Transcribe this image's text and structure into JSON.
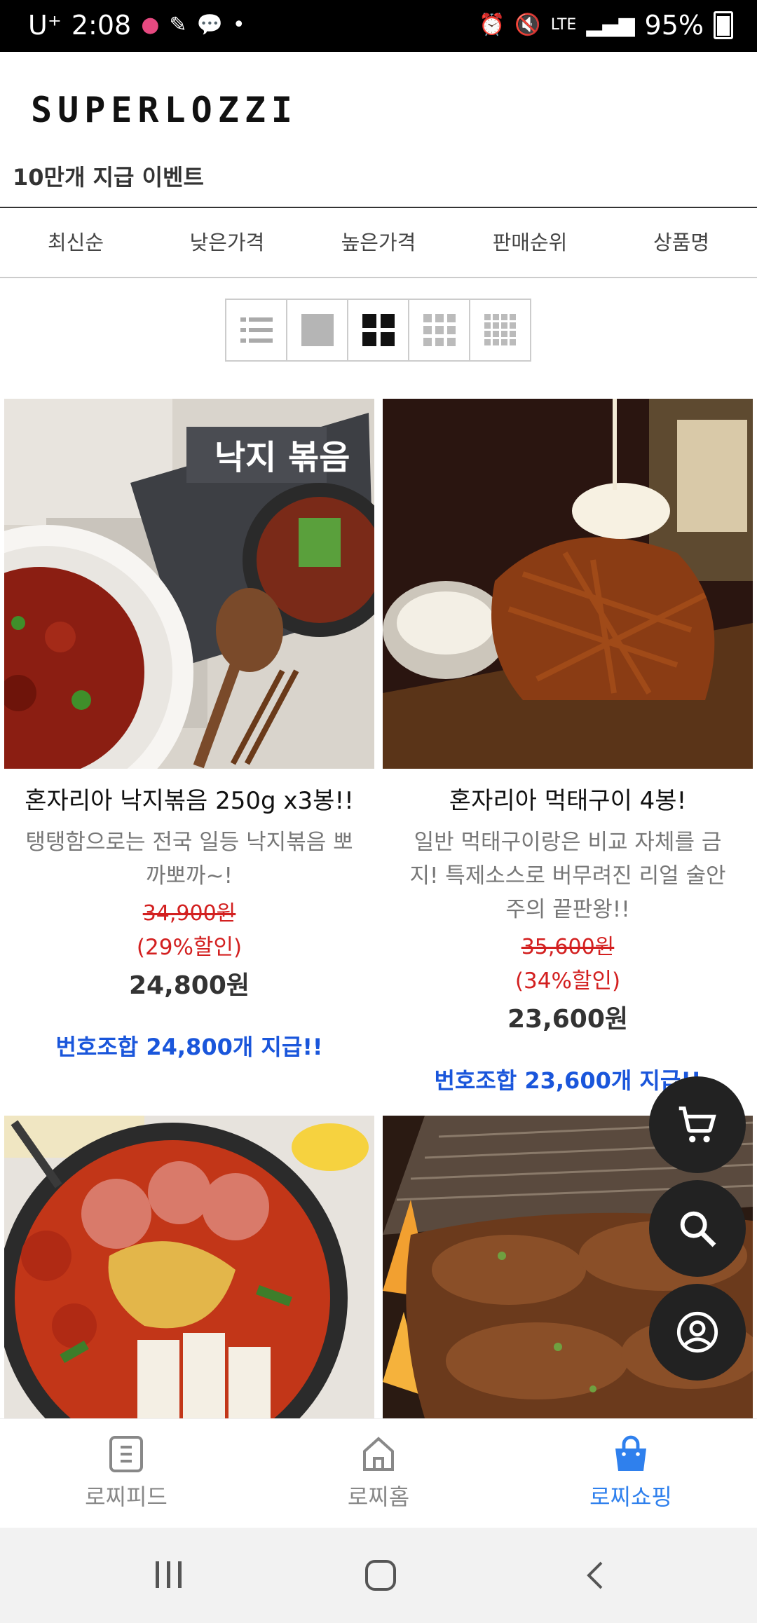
{
  "status_bar": {
    "carrier": "U⁺",
    "time": "2:08",
    "network": "LTE",
    "battery": "95%"
  },
  "header": {
    "logo_text": "SUPERLOZZI",
    "event_title": "10만개 지급 이벤트"
  },
  "sort_tabs": [
    "최신순",
    "낮은가격",
    "높은가격",
    "판매순위",
    "상품명"
  ],
  "view_modes": [
    {
      "icon": "list-view-icon"
    },
    {
      "icon": "single-view-icon"
    },
    {
      "icon": "grid-2-view-icon"
    },
    {
      "icon": "grid-3-view-icon"
    },
    {
      "icon": "grid-4-view-icon"
    }
  ],
  "products": [
    {
      "name": "혼자리아 낙지볶음 250g x3봉!!",
      "desc": "탱탱함으로는 전국 일등 낙지볶음 뽀까뽀까~!",
      "original_price": "34,900원",
      "discount": "(29%할인)",
      "price": "24,800원",
      "promo": "번호조합 24,800개 지급!!",
      "image_text": "낙지 볶음"
    },
    {
      "name": "혼자리아 먹태구이 4봉!",
      "desc": "일반 먹태구이랑은 비교 자체를 금지! 특제소스로 버무려진 리얼 술안주의 끝판왕!!",
      "original_price": "35,600원",
      "discount": "(34%할인)",
      "price": "23,600원",
      "promo": "번호조합 23,600개 지급!!"
    }
  ],
  "bottom_nav": [
    {
      "label": "로찌피드",
      "icon": "feed-icon"
    },
    {
      "label": "로찌홈",
      "icon": "home-icon"
    },
    {
      "label": "로찌쇼핑",
      "icon": "shopping-bag-icon",
      "active": true
    }
  ],
  "colors": {
    "accent_blue": "#1a56db",
    "nav_active": "#2f80ed",
    "sale_red": "#d32020"
  }
}
